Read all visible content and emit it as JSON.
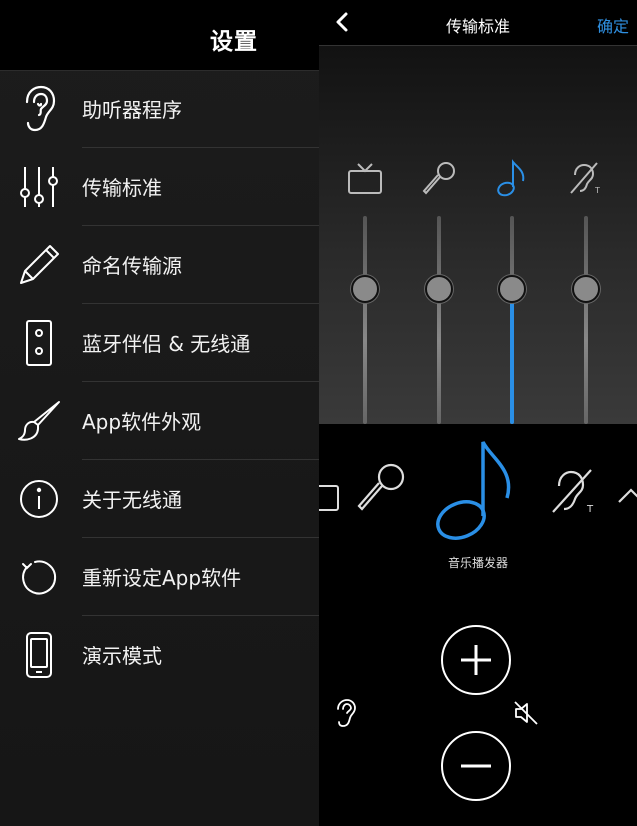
{
  "settings": {
    "title": "设置",
    "items": [
      {
        "label": "助听器程序",
        "icon": "ear-icon"
      },
      {
        "label": "传输标准",
        "icon": "sliders-icon"
      },
      {
        "label": "命名传输源",
        "icon": "pencil-icon"
      },
      {
        "label": "蓝牙伴侣 & 无线通",
        "icon": "remote-device-icon"
      },
      {
        "label": "App软件外观",
        "icon": "paintbrush-icon"
      },
      {
        "label": "关于无线通",
        "icon": "info-icon"
      },
      {
        "label": "重新设定App软件",
        "icon": "reset-icon"
      },
      {
        "label": "演示模式",
        "icon": "phone-icon"
      }
    ]
  },
  "transmission": {
    "back_icon": "chevron-left-icon",
    "title": "传输标准",
    "confirm_label": "确定",
    "channels": [
      {
        "icon": "tv-icon",
        "level": 0.5,
        "selected": false
      },
      {
        "icon": "microphone-icon",
        "level": 0.5,
        "selected": false
      },
      {
        "icon": "music-note-icon",
        "level": 0.5,
        "selected": true
      },
      {
        "icon": "hearing-loop-icon",
        "level": 0.5,
        "selected": false
      }
    ],
    "colors": {
      "accent": "#2a8fe6",
      "text": "#ffffff"
    }
  },
  "source": {
    "carousel": [
      "tv-icon",
      "microphone-icon",
      "music-note-icon",
      "hearing-loop-icon",
      "chevron-right-icon"
    ],
    "selected_label": "音乐播发器",
    "plus_icon": "plus-icon",
    "minus_icon": "minus-icon",
    "ear_icon": "ear-icon",
    "mute_icon": "speaker-mute-icon"
  }
}
